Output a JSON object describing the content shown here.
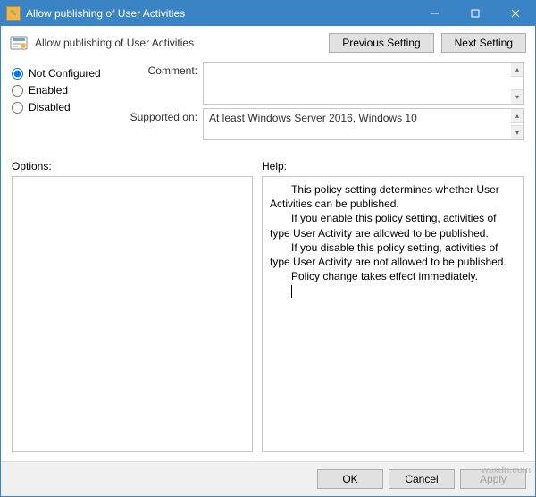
{
  "window": {
    "title": "Allow publishing of User Activities"
  },
  "subtitle": "Allow publishing of User Activities",
  "nav": {
    "prev": "Previous Setting",
    "next": "Next Setting"
  },
  "state": {
    "options": [
      {
        "label": "Not Configured",
        "checked": true
      },
      {
        "label": "Enabled",
        "checked": false
      },
      {
        "label": "Disabled",
        "checked": false
      }
    ]
  },
  "meta": {
    "comment_label": "Comment:",
    "comment_value": "",
    "supported_label": "Supported on:",
    "supported_value": "At least Windows Server 2016, Windows 10"
  },
  "sections": {
    "options_label": "Options:",
    "help_label": "Help:"
  },
  "help": {
    "p1": "This policy setting determines whether User Activities can be published.",
    "p2": "If you enable this policy setting, activities of type User Activity are allowed to be published.",
    "p3": "If you disable this policy setting, activities of type User Activity are not allowed to be published.",
    "p4": "Policy change takes effect immediately."
  },
  "footer": {
    "ok": "OK",
    "cancel": "Cancel",
    "apply": "Apply"
  },
  "watermark": "wsxdn.com"
}
